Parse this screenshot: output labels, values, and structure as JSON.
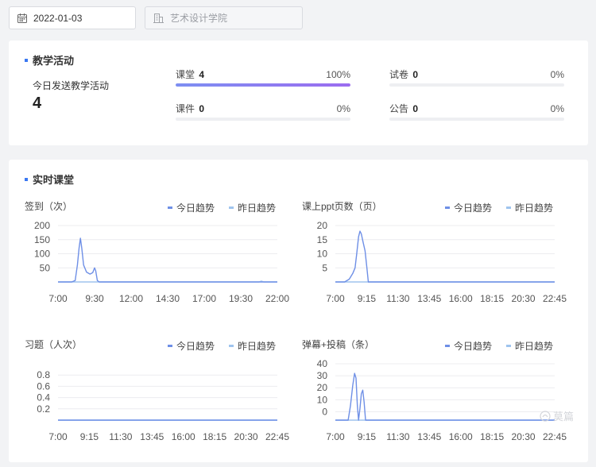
{
  "topbar": {
    "date": "2022-01-03",
    "department_placeholder": "艺术设计学院"
  },
  "activity": {
    "title": "教学活动",
    "today_label": "今日发送教学活动",
    "today_count": "4",
    "items": [
      {
        "name": "课堂",
        "count": "4",
        "percent": "100%",
        "progress": 1.0
      },
      {
        "name": "试卷",
        "count": "0",
        "percent": "0%",
        "progress": 0
      },
      {
        "name": "课件",
        "count": "0",
        "percent": "0%",
        "progress": 0
      },
      {
        "name": "公告",
        "count": "0",
        "percent": "0%",
        "progress": 0
      }
    ]
  },
  "live": {
    "title": "实时课堂"
  },
  "colors": {
    "today": "#6e8fe6",
    "yesterday": "#9fc4ee",
    "accent": "#3a78f2"
  },
  "watermark": "莫篇",
  "chart_data": [
    {
      "type": "line",
      "title": "签到（次）",
      "legend": [
        "今日趋势",
        "昨日趋势"
      ],
      "x_ticks": [
        "7:00",
        "9:30",
        "12:00",
        "14:30",
        "17:00",
        "19:30",
        "22:00"
      ],
      "x_range": [
        420,
        1380
      ],
      "y_ticks": [
        50,
        100,
        150,
        200
      ],
      "ylim": [
        0,
        200
      ],
      "series": [
        {
          "name": "今日趋势",
          "points": [
            [
              420,
              0
            ],
            [
              480,
              0
            ],
            [
              495,
              5
            ],
            [
              505,
              60
            ],
            [
              512,
              120
            ],
            [
              518,
              155
            ],
            [
              524,
              120
            ],
            [
              532,
              60
            ],
            [
              545,
              35
            ],
            [
              560,
              28
            ],
            [
              572,
              33
            ],
            [
              580,
              50
            ],
            [
              585,
              40
            ],
            [
              592,
              5
            ],
            [
              600,
              0
            ],
            [
              1380,
              0
            ]
          ]
        },
        {
          "name": "昨日趋势",
          "points": [
            [
              420,
              0
            ],
            [
              1300,
              0
            ],
            [
              1310,
              3
            ],
            [
              1320,
              0
            ],
            [
              1380,
              0
            ]
          ]
        }
      ]
    },
    {
      "type": "line",
      "title": "课上ppt页数（页）",
      "legend": [
        "今日趋势",
        "昨日趋势"
      ],
      "x_ticks": [
        "7:00",
        "9:15",
        "11:30",
        "13:45",
        "16:00",
        "18:15",
        "20:30",
        "22:45"
      ],
      "x_range": [
        420,
        1365
      ],
      "y_ticks": [
        5,
        10,
        15,
        20
      ],
      "ylim": [
        0,
        20
      ],
      "series": [
        {
          "name": "今日趋势",
          "points": [
            [
              420,
              0
            ],
            [
              460,
              0
            ],
            [
              480,
              1
            ],
            [
              495,
              3
            ],
            [
              505,
              5
            ],
            [
              512,
              10
            ],
            [
              520,
              16
            ],
            [
              526,
              18
            ],
            [
              532,
              17
            ],
            [
              540,
              14
            ],
            [
              548,
              11
            ],
            [
              556,
              5
            ],
            [
              562,
              0
            ],
            [
              1365,
              0
            ]
          ]
        },
        {
          "name": "昨日趋势",
          "points": [
            [
              420,
              0
            ],
            [
              1365,
              0
            ]
          ]
        }
      ]
    },
    {
      "type": "line",
      "title": "习题（人次）",
      "legend": [
        "今日趋势",
        "昨日趋势"
      ],
      "x_ticks": [
        "7:00",
        "9:15",
        "11:30",
        "13:45",
        "16:00",
        "18:15",
        "20:30",
        "22:45"
      ],
      "x_range": [
        420,
        1365
      ],
      "y_ticks": [
        0.2,
        0.4,
        0.6,
        0.8
      ],
      "ylim": [
        0,
        1
      ],
      "series": [
        {
          "name": "今日趋势",
          "points": [
            [
              420,
              0
            ],
            [
              1365,
              0
            ]
          ]
        },
        {
          "name": "昨日趋势",
          "points": [
            [
              420,
              0
            ],
            [
              1365,
              0
            ]
          ]
        }
      ]
    },
    {
      "type": "line",
      "title": "弹幕+投稿（条）",
      "legend": [
        "今日趋势",
        "昨日趋势"
      ],
      "x_ticks": [
        "7:00",
        "9:15",
        "11:30",
        "13:45",
        "16:00",
        "18:15",
        "20:30",
        "22:45"
      ],
      "x_range": [
        420,
        1365
      ],
      "y_ticks": [
        0,
        10,
        20,
        30,
        40
      ],
      "ylim": [
        -7,
        40
      ],
      "series": [
        {
          "name": "今日趋势",
          "points": [
            [
              420,
              -7
            ],
            [
              475,
              -7
            ],
            [
              485,
              5
            ],
            [
              495,
              22
            ],
            [
              503,
              32
            ],
            [
              509,
              28
            ],
            [
              515,
              5
            ],
            [
              520,
              -7
            ],
            [
              526,
              3
            ],
            [
              532,
              15
            ],
            [
              538,
              18
            ],
            [
              544,
              8
            ],
            [
              550,
              -7
            ],
            [
              1365,
              -7
            ]
          ]
        },
        {
          "name": "昨日趋势",
          "points": [
            [
              420,
              -7
            ],
            [
              1365,
              -7
            ]
          ]
        }
      ]
    }
  ]
}
